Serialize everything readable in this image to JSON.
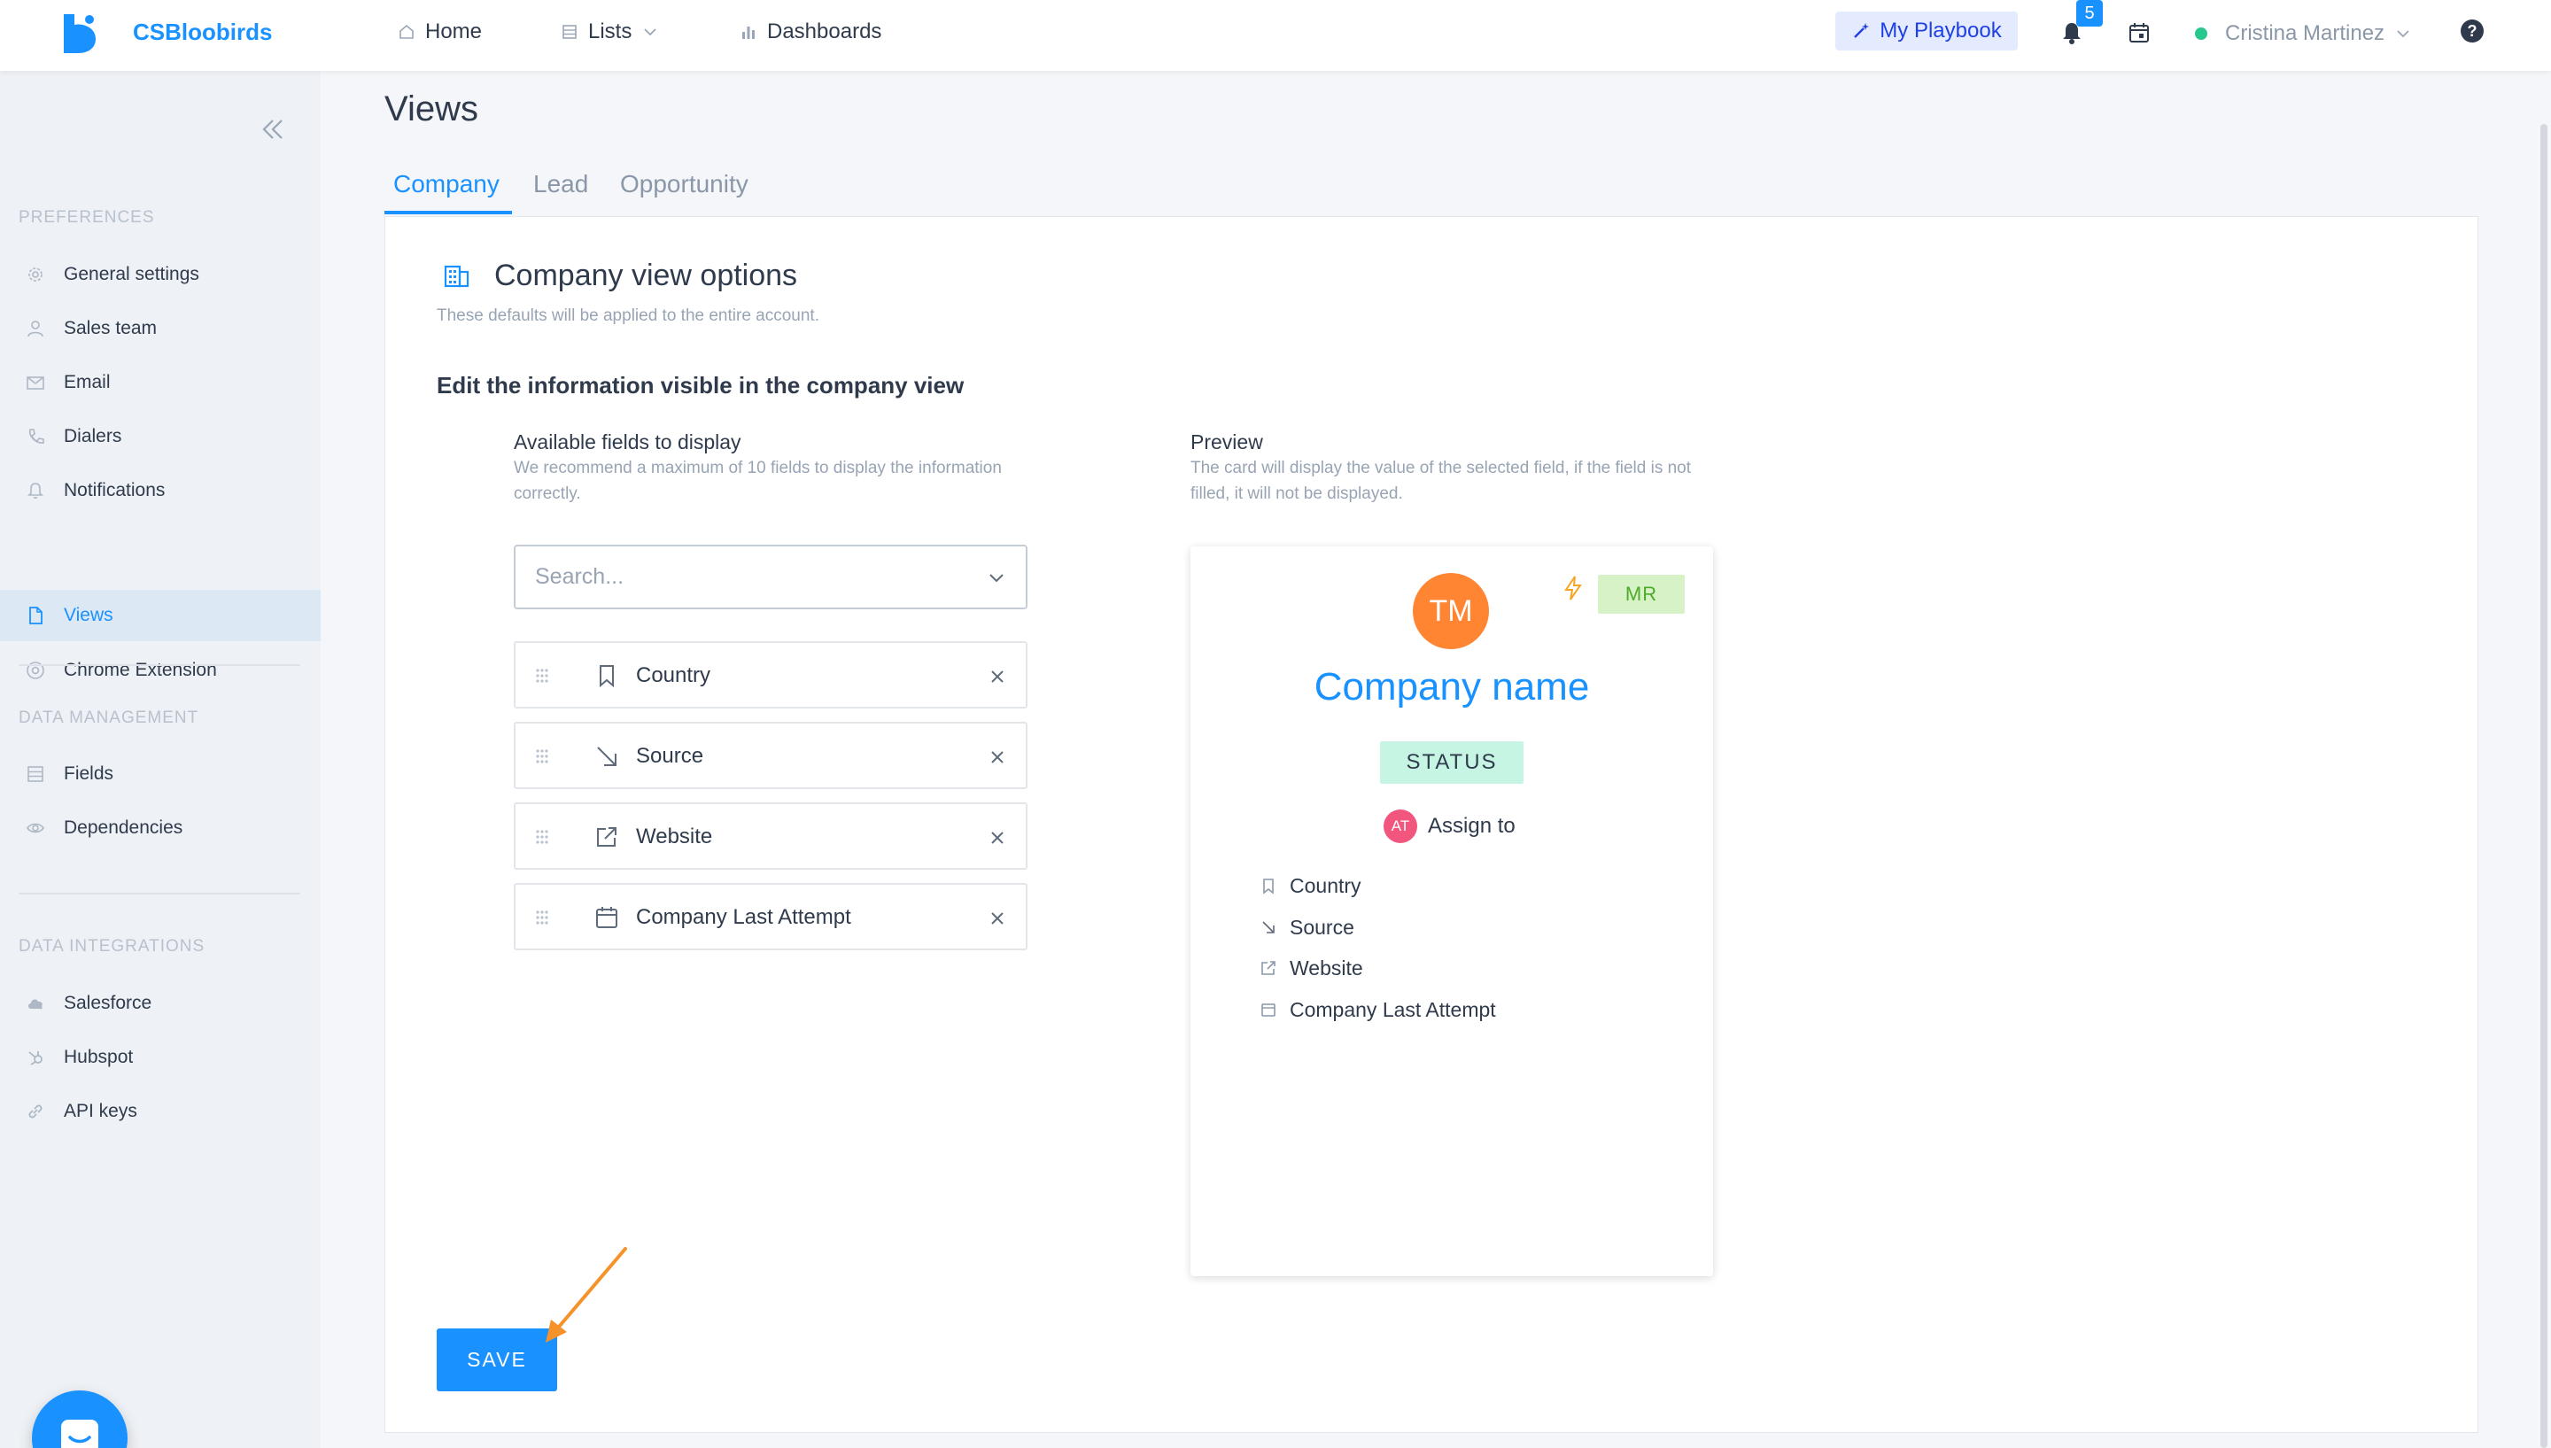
{
  "topbar": {
    "brand": "CSBloobirds",
    "nav": [
      {
        "label": "Home",
        "icon": "home-icon"
      },
      {
        "label": "Lists",
        "icon": "list-icon"
      },
      {
        "label": "Dashboards",
        "icon": "bar-chart-icon"
      }
    ],
    "playbook_label": "My Playbook",
    "notification_count": "5",
    "user_name": "Cristina Martinez",
    "help_glyph": "?"
  },
  "sidebar": {
    "sections": [
      {
        "title": "PREFERENCES",
        "items": [
          {
            "label": "General settings",
            "icon": "gear-icon"
          },
          {
            "label": "Sales team",
            "icon": "user-icon"
          },
          {
            "label": "Email",
            "icon": "mail-icon"
          },
          {
            "label": "Dialers",
            "icon": "phone-icon"
          },
          {
            "label": "Notifications",
            "icon": "bell-icon"
          },
          {
            "label": "Views",
            "icon": "document-icon",
            "active": true
          },
          {
            "label": "Chrome Extension",
            "icon": "chrome-icon"
          }
        ]
      },
      {
        "title": "DATA MANAGEMENT",
        "items": [
          {
            "label": "Fields",
            "icon": "list-icon"
          },
          {
            "label": "Dependencies",
            "icon": "eye-icon"
          }
        ]
      },
      {
        "title": "DATA INTEGRATIONS",
        "items": [
          {
            "label": "Salesforce",
            "icon": "cloud-icon"
          },
          {
            "label": "Hubspot",
            "icon": "hubspot-icon"
          },
          {
            "label": "API keys",
            "icon": "link-icon"
          }
        ]
      }
    ]
  },
  "main": {
    "title": "Views",
    "tabs": [
      {
        "label": "Company",
        "active": true
      },
      {
        "label": "Lead"
      },
      {
        "label": "Opportunity"
      }
    ],
    "options_title": "Company view options",
    "options_subtitle": "These defaults will be applied to the entire account.",
    "edit_title": "Edit the information visible in the company view",
    "available": {
      "title": "Available fields to display",
      "description": "We recommend a maximum of 10 fields to display the information correctly.",
      "search_placeholder": "Search...",
      "fields": [
        {
          "label": "Country",
          "icon": "bookmark-icon"
        },
        {
          "label": "Source",
          "icon": "arrow-down-right-icon"
        },
        {
          "label": "Website",
          "icon": "external-link-icon"
        },
        {
          "label": "Company Last Attempt",
          "icon": "calendar-icon"
        }
      ]
    },
    "preview": {
      "title": "Preview",
      "description": "The card will display the value of the selected field, if the field is not filled, it will not be displayed.",
      "avatar_initials": "TM",
      "tag": "MR",
      "company_name": "Company name",
      "status": "STATUS",
      "assign_initials": "AT",
      "assign_label": "Assign to",
      "fields": [
        {
          "label": "Country",
          "icon": "bookmark-icon"
        },
        {
          "label": "Source",
          "icon": "arrow-down-right-icon"
        },
        {
          "label": "Website",
          "icon": "external-link-icon"
        },
        {
          "label": "Company Last Attempt",
          "icon": "calendar-icon"
        }
      ]
    },
    "save_label": "SAVE"
  },
  "colors": {
    "accent": "#1991ff",
    "avatar": "#ff8533",
    "status_bg": "#c6f5e3",
    "tag_bg": "#d6f2c6",
    "arrow": "#f5922a"
  }
}
